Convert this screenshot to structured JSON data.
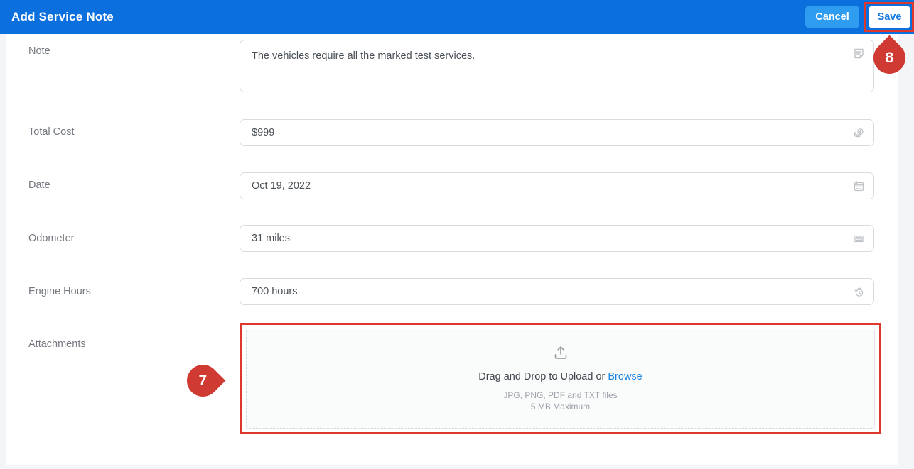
{
  "header": {
    "title": "Add Service Note",
    "cancel_label": "Cancel",
    "save_label": "Save"
  },
  "form": {
    "note": {
      "label": "Note",
      "value": "The vehicles require all the marked test services."
    },
    "total_cost": {
      "label": "Total Cost",
      "value": "$999"
    },
    "date": {
      "label": "Date",
      "value": "Oct 19, 2022"
    },
    "odometer": {
      "label": "Odometer",
      "value": "31 miles"
    },
    "engine_hours": {
      "label": "Engine Hours",
      "value": "700 hours"
    },
    "attachments": {
      "label": "Attachments",
      "drag_text": "Drag and Drop to Upload or ",
      "browse_label": "Browse",
      "filetypes_text": "JPG, PNG, PDF and TXT files",
      "size_text": "5 MB Maximum"
    }
  },
  "annotations": {
    "marker_7": "7",
    "marker_8": "8"
  },
  "icons": {
    "note_field": "memo-icon",
    "total_cost_field": "coins-icon",
    "date_field": "calendar-icon",
    "odometer_field": "odometer-icon",
    "engine_hours_field": "timer-icon",
    "dropzone": "upload-icon"
  },
  "colors": {
    "header_blue": "#0b70dd",
    "cancel_button_blue": "#2e9cf0",
    "save_text_blue": "#1879e0",
    "annotation_rect_red": "#dd382c",
    "annotation_marker_red": "#cf3a33",
    "browse_link_blue": "#1a82e2"
  }
}
